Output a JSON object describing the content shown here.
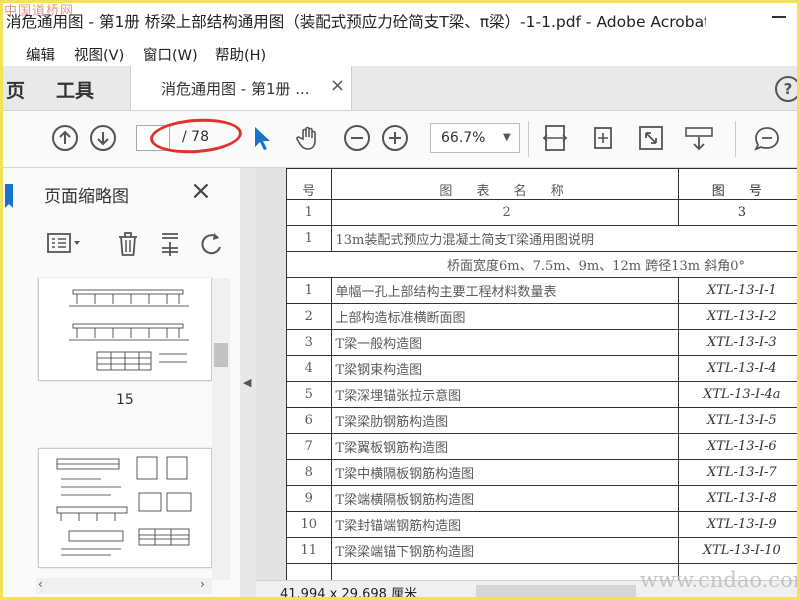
{
  "window": {
    "title": "消危通用图 - 第1册 桥梁上部结构通用图（装配式预应力砼简支T梁、π梁）-1-1.pdf - Adobe Acrobat...",
    "watermark_top": "中国道桥网"
  },
  "menu": [
    "编辑",
    "视图(V)",
    "窗口(W)",
    "帮助(H)"
  ],
  "tabs": {
    "home_partial": "页",
    "tools": "工具",
    "doc_tab": "消危通用图 - 第1册 ...",
    "close": "×",
    "help": "?"
  },
  "toolbar": {
    "page_current": "",
    "page_total": "/ 78",
    "zoom": "66.7%"
  },
  "thumbs_panel": {
    "title": "页面缩略图",
    "close": "×",
    "pages": [
      "15"
    ]
  },
  "document": {
    "header": {
      "col1": "号",
      "col2": "图 表 名 称",
      "col3": "图 号"
    },
    "index_row": [
      "1",
      "2",
      "3"
    ],
    "section_title": {
      "no": "1",
      "text": "13m装配式预应力混凝土简支T梁通用图说明"
    },
    "subtitle": "桥面宽度6m、7.5m、9m、12m 跨径13m 斜角0°",
    "rows": [
      {
        "no": "1",
        "name": "单幅一孔上部结构主要工程材料数量表",
        "code": "XTL-13-I-1"
      },
      {
        "no": "2",
        "name": "上部构造标准横断面图",
        "code": "XTL-13-I-2"
      },
      {
        "no": "3",
        "name": "T梁一般构造图",
        "code": "XTL-13-I-3"
      },
      {
        "no": "4",
        "name": "T梁钢束构造图",
        "code": "XTL-13-I-4"
      },
      {
        "no": "5",
        "name": "T梁深埋锚张拉示意图",
        "code": "XTL-13-I-4a"
      },
      {
        "no": "6",
        "name": "T梁梁肋钢筋构造图",
        "code": "XTL-13-I-5"
      },
      {
        "no": "7",
        "name": "T梁翼板钢筋构造图",
        "code": "XTL-13-I-6"
      },
      {
        "no": "8",
        "name": "T梁中横隔板钢筋构造图",
        "code": "XTL-13-I-7"
      },
      {
        "no": "9",
        "name": "T梁端横隔板钢筋构造图",
        "code": "XTL-13-I-8"
      },
      {
        "no": "10",
        "name": "T梁封锚端钢筋构造图",
        "code": "XTL-13-I-9"
      },
      {
        "no": "11",
        "name": "T梁梁端锚下钢筋构造图",
        "code": "XTL-13-I-10"
      }
    ],
    "dimensions": "41.994 x 29.698 厘米"
  },
  "watermark_bottom": "www.cndao.com",
  "colors": {
    "accent_blue": "#1a73c8",
    "annotation_red": "#e0322c",
    "frame_yellow": "#f2e25a"
  }
}
